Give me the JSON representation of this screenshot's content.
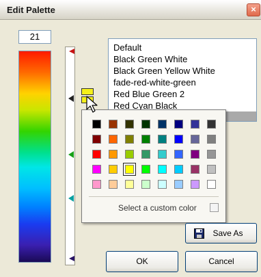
{
  "window": {
    "title": "Edit Palette",
    "close_symbol": "×"
  },
  "value_display": "21",
  "palettes": [
    "Default",
    "Black Green White",
    "Black Green Yellow White",
    "fade-red-white-green",
    "Red Blue Green 2",
    "Red Cyan Black",
    ""
  ],
  "color_popup": {
    "colors": [
      [
        "#000000",
        "#993300",
        "#333300",
        "#003300",
        "#003366",
        "#000080",
        "#333399",
        "#333333"
      ],
      [
        "#800000",
        "#FF6600",
        "#808000",
        "#008000",
        "#008080",
        "#0000FF",
        "#666699",
        "#808080"
      ],
      [
        "#FF0000",
        "#FF9900",
        "#99CC00",
        "#339966",
        "#33CCCC",
        "#3366FF",
        "#800080",
        "#969696"
      ],
      [
        "#FF00FF",
        "#FFCC00",
        "#FFFF00",
        "#00FF00",
        "#00FFFF",
        "#00CCFF",
        "#993366",
        "#C0C0C0"
      ],
      [
        "#FF99CC",
        "#FFCC99",
        "#FFFF99",
        "#CCFFCC",
        "#CCFFFF",
        "#99CCFF",
        "#CC99FF",
        "#FFFFFF"
      ]
    ],
    "selected_color": "#FFFF00",
    "custom_label": "Select a custom color"
  },
  "buttons": {
    "save_as": "Save As",
    "ok": "OK",
    "cancel": "Cancel"
  },
  "icons": {
    "close": "close-icon",
    "save": "floppy-disk-icon",
    "cursor": "mouse-pointer-icon",
    "marker": "slider-marker-icon"
  }
}
